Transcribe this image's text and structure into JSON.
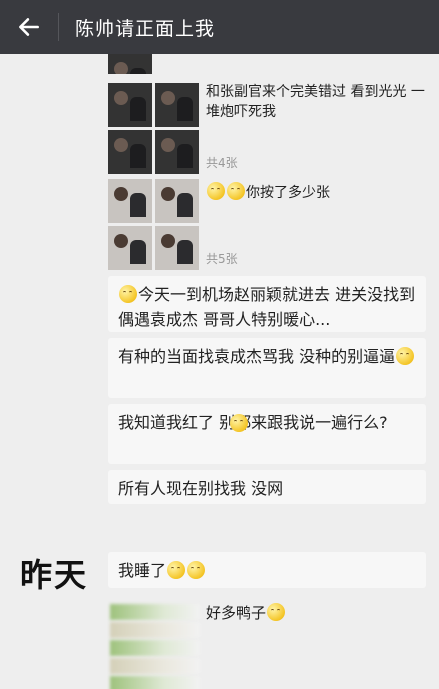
{
  "header": {
    "title": "陈帅请正面上我",
    "back_icon": "arrow-left-icon"
  },
  "feed": {
    "post1": {
      "text": "和张副官来个完美错过 看到光光 一堆炮吓死我",
      "count": "共4张"
    },
    "post2": {
      "text": "你按了多少张",
      "count": "共5张"
    },
    "bubbles": [
      {
        "text": "今天一到机场赵丽颖就进去 进关没找到偶遇袁成杰 哥哥人特别暖心..."
      },
      {
        "text": "有种的当面找袁成杰骂我 没种的别逼逼"
      },
      {
        "text": "我知道我红了 别都来跟我说一遍行么?"
      },
      {
        "text": "所有人现在别找我 没网"
      },
      {
        "text": "我睡了"
      }
    ],
    "date_label": "昨天",
    "side_text": "好多鸭子"
  },
  "colors": {
    "topbar": "#393a3f",
    "feed_bg": "#eeeeee",
    "bubble_bg": "#f7f7f7"
  }
}
